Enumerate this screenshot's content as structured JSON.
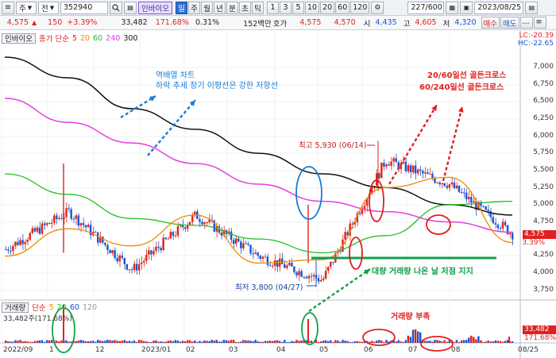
{
  "toolbar": {
    "menu_icon": "≡",
    "market_select": "주",
    "type_select": "전",
    "code_value": "352940",
    "search_icon": "search-icon",
    "tag_label": "인바이오",
    "periods": [
      "일",
      "주",
      "월",
      "년",
      "분",
      "초",
      "틱"
    ],
    "intervals": [
      "1",
      "3",
      "5",
      "10",
      "20",
      "60",
      "120"
    ],
    "count_value": "227/600",
    "date_value": "2023/08/25"
  },
  "quote": {
    "price": "4,575",
    "change": "150",
    "change_pct": "+3.39%",
    "volume": "33,482",
    "turnover_pct": "171.68%",
    "rate": "0.31%",
    "amount": "152백만",
    "ask_label": "호가",
    "ask1": "4,575",
    "ask2": "4,570",
    "open_label": "시",
    "open_price": "4,435",
    "high_label": "고",
    "high_price": "4,605",
    "low_label": "저",
    "low_price": "4,320",
    "buy_label": "매수",
    "sell_label": "매도",
    "more_label": "...",
    "menu_label": "≡"
  },
  "legend": {
    "name": "인바이오",
    "type": "종가 단순",
    "ma5": "5",
    "ma20": "20",
    "ma60": "60",
    "ma240": "240",
    "ma300": "300"
  },
  "volume_legend": {
    "name": "거래량",
    "type": "단순",
    "p5": "5",
    "p20": "20",
    "p60": "60",
    "p120": "120",
    "value": "33,482주(171.68%)"
  },
  "axis": {
    "lc": "LC:-20.39",
    "hc": "HC:-22.65",
    "price_ticks": [
      "7,000",
      "6,750",
      "6,500",
      "6,250",
      "6,000",
      "5,750",
      "5,500",
      "5,250",
      "5,000",
      "4,750",
      "4,250",
      "4,000",
      "3,750"
    ],
    "current_price": "4,575",
    "current_pct": "3.39%",
    "volume_tag": "33,482",
    "volume_pct": "171.68%",
    "x_ticks": [
      "2022/09",
      "1",
      "12",
      "2023/01",
      "02",
      "03",
      "04",
      "05",
      "06",
      "07",
      "08",
      "08/25"
    ]
  },
  "annotations": {
    "reverse_line1": "역배열 차트",
    "reverse_line2": "하락 추세 장기 이평선은 강한 저항선",
    "cross1": "20/60일선 골든크로스",
    "cross2": "60/240일선 골든크로스",
    "high_mark": "최고 5,930 (06/14)",
    "low_mark": "최저 3,800 (04/27)",
    "support": "대량 거래량 나온 날 저점 지지",
    "volume_short": "거래량 부족"
  },
  "chart_data": {
    "type": "line",
    "title": "",
    "x_range": [
      "2022/09",
      "2023/08/25"
    ],
    "ylim": [
      3600,
      7200
    ],
    "series": [
      {
        "name": "300",
        "color": "#111111",
        "values": [
          7150,
          6850,
          6400,
          6100,
          5750,
          5450,
          5250,
          5000,
          4850
        ]
      },
      {
        "name": "240",
        "color": "#e040e0",
        "values": [
          6550,
          6200,
          5900,
          5600,
          5300,
          5050,
          4900,
          4750,
          4600
        ]
      },
      {
        "name": "60",
        "color": "#22c022",
        "values": [
          5450,
          5150,
          4800,
          4700,
          4500,
          4300,
          4550,
          5000,
          5050
        ]
      },
      {
        "name": "20",
        "color": "#f08a00",
        "values": [
          4250,
          4650,
          4400,
          4850,
          4150,
          4200,
          5250,
          5400,
          4450
        ]
      },
      {
        "name": "종가",
        "color": "#e02020",
        "values": [
          4350,
          4900,
          4050,
          4850,
          4250,
          3900,
          5650,
          5300,
          4575
        ]
      }
    ],
    "high": {
      "label": "최고",
      "value": 5930,
      "date": "06/14"
    },
    "low": {
      "label": "최저",
      "value": 3800,
      "date": "04/27"
    },
    "current": 4575
  },
  "colors": {
    "accent": "#2f6fd6",
    "up": "#e0241b",
    "down": "#1d55d1",
    "ma5": "#e02020",
    "ma20": "#f08a00",
    "ma60": "#22c022",
    "ma240": "#e040e0",
    "ma300": "#111111",
    "support": "#10a048"
  }
}
